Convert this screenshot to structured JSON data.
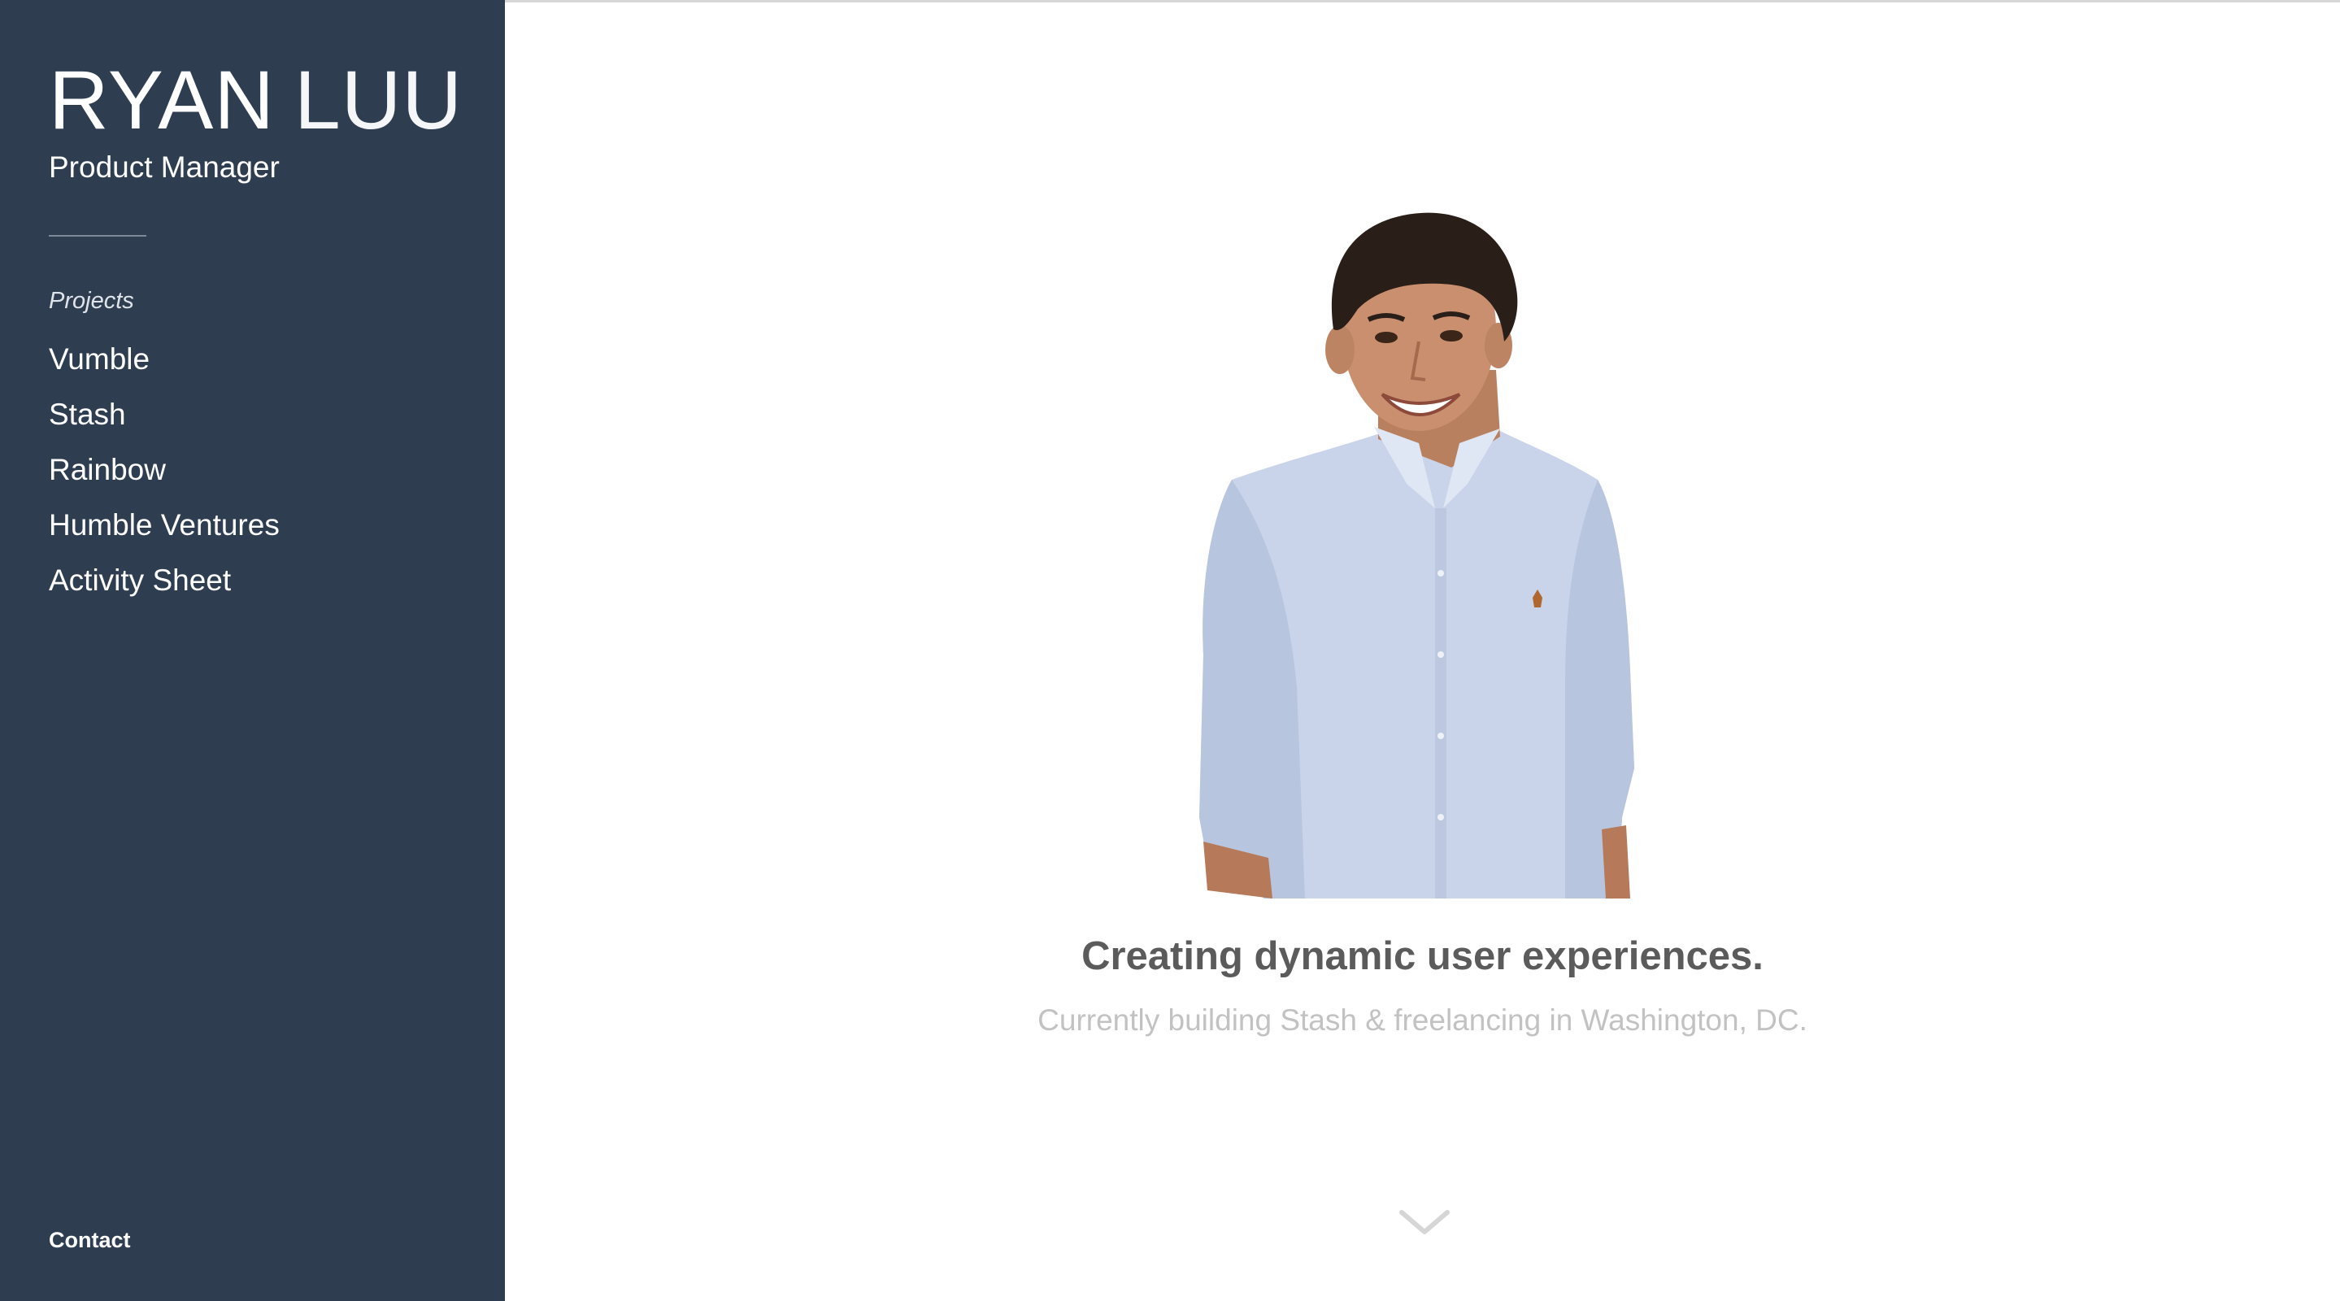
{
  "sidebar": {
    "brand_first": "RYAN",
    "brand_last": "LUU",
    "role": "Product Manager",
    "section_label": "Projects",
    "items": [
      {
        "label": "Vumble"
      },
      {
        "label": "Stash"
      },
      {
        "label": "Rainbow"
      },
      {
        "label": "Humble Ventures"
      },
      {
        "label": "Activity Sheet"
      }
    ],
    "contact": "Contact"
  },
  "hero": {
    "headline": "Creating dynamic user experiences.",
    "subline": "Currently building Stash & freelancing in Washington, DC."
  },
  "icons": {
    "scroll": "chevron-down-icon"
  },
  "colors": {
    "sidebar_bg": "#2e3e50",
    "headline": "#5b5b5b",
    "subline": "#c2c2c2",
    "shirt": "#c9d4ea",
    "hair": "#2a1e18",
    "skin": "#c98f6f"
  }
}
